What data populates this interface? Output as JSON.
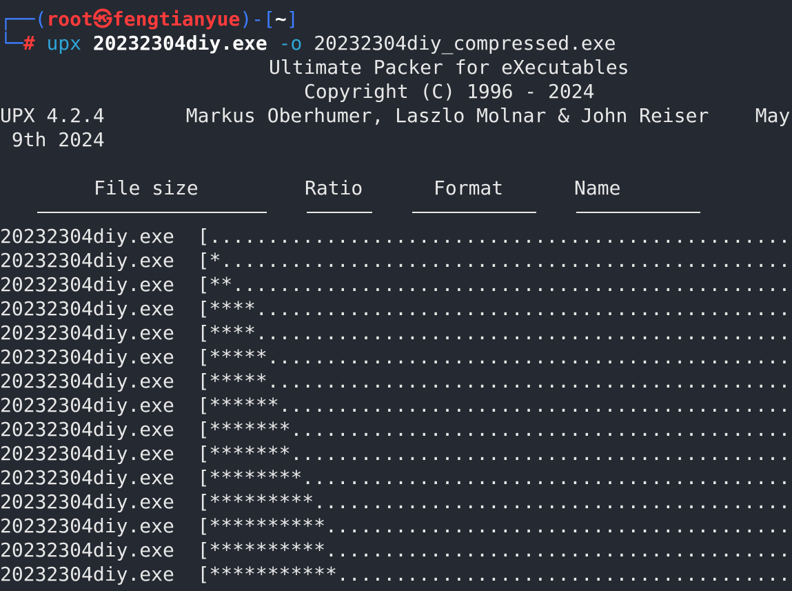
{
  "prompt": {
    "corner_top": "┌──(",
    "user": "root",
    "at_symbol": "㉿",
    "host": "fengtianyue",
    "mid": ")-[",
    "cwd": "~",
    "end": "]",
    "corner_bottom": "└─",
    "hash": "#"
  },
  "command": {
    "program": "upx",
    "input_file": "20232304diy.exe",
    "flag": "-o",
    "output_file": "20232304diy_compressed.exe"
  },
  "banner": {
    "line1": "Ultimate Packer for eXecutables",
    "line2": "Copyright (C) 1996 - 2024",
    "line3": "UPX 4.2.4       Markus Oberhumer, Laszlo Molnar & John Reiser    May",
    "line4": " 9th 2024"
  },
  "table_header": {
    "file_size": "File size",
    "ratio": "Ratio",
    "format": "Format",
    "name": "Name"
  },
  "progress_rows": [
    {
      "file": "20232304diy.exe",
      "bar": "[...................................................]"
    },
    {
      "file": "20232304diy.exe",
      "bar": "[*..................................................]"
    },
    {
      "file": "20232304diy.exe",
      "bar": "[**.................................................]"
    },
    {
      "file": "20232304diy.exe",
      "bar": "[****...............................................]"
    },
    {
      "file": "20232304diy.exe",
      "bar": "[****...............................................]"
    },
    {
      "file": "20232304diy.exe",
      "bar": "[*****..............................................]"
    },
    {
      "file": "20232304diy.exe",
      "bar": "[*****..............................................]"
    },
    {
      "file": "20232304diy.exe",
      "bar": "[******.............................................]"
    },
    {
      "file": "20232304diy.exe",
      "bar": "[*******............................................]"
    },
    {
      "file": "20232304diy.exe",
      "bar": "[*******............................................]"
    },
    {
      "file": "20232304diy.exe",
      "bar": "[********...........................................]"
    },
    {
      "file": "20232304diy.exe",
      "bar": "[*********..........................................]"
    },
    {
      "file": "20232304diy.exe",
      "bar": "[**********.........................................]"
    },
    {
      "file": "20232304diy.exe",
      "bar": "[**********.........................................]"
    },
    {
      "file": "20232304diy.exe",
      "bar": "[***********........................................]"
    }
  ],
  "colors": {
    "background": "#252931",
    "prompt_frame": "#3d7dff",
    "prompt_user": "#ff3b3b",
    "command": "#2ea6d8",
    "text": "#e8e8e8"
  }
}
